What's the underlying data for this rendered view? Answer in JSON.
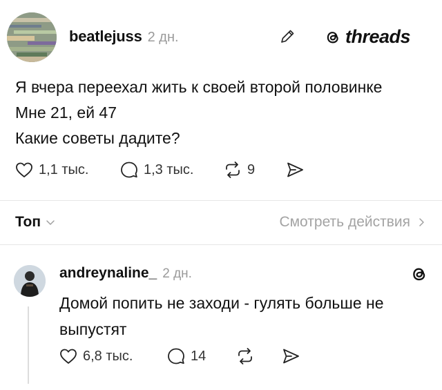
{
  "post": {
    "author": "beatlejuss",
    "time": "2 дн.",
    "brand": "threads",
    "lines": [
      "Я вчера переехал жить к своей второй половинке",
      "Мне 21, ей 47",
      "Какие советы дадите?"
    ],
    "likes": "1,1 тыс.",
    "replies": "1,3 тыс.",
    "reposts": "9"
  },
  "sort": {
    "label": "Топ",
    "activity": "Смотреть действия"
  },
  "reply": {
    "author": "andreynaline_",
    "time": "2 дн.",
    "lines": [
      "Домой попить не заходи - гулять больше не",
      "выпустят"
    ],
    "likes": "6,8 тыс.",
    "replies": "14"
  },
  "icons": {
    "like": "heart-icon",
    "reply": "comment-icon",
    "repost": "repost-icon",
    "share": "share-icon",
    "edit": "pencil-icon",
    "brand": "threads-logo-icon",
    "chevron_down": "chevron-down-icon",
    "chevron_right": "chevron-right-icon"
  },
  "colors": {
    "text": "#111111",
    "muted": "#9a9a9a",
    "divider": "#e6e6e6",
    "activity": "#a3a3a3"
  }
}
